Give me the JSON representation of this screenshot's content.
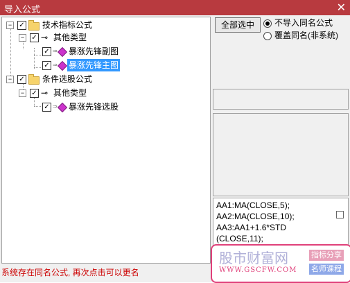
{
  "window": {
    "title": "导入公式",
    "close_glyph": "✕"
  },
  "tree": {
    "groups": [
      {
        "label": "技术指标公式",
        "subgroup": "其他类型",
        "items": [
          "暴涨先锋副图",
          "暴涨先锋主图"
        ]
      },
      {
        "label": "条件选股公式",
        "subgroup": "其他类型",
        "items": [
          "暴涨先锋选股"
        ]
      }
    ],
    "selected_item": "暴涨先锋主图"
  },
  "actions": {
    "select_all": "全部选中"
  },
  "options": {
    "no_import_same": "不导入同名公式",
    "overwrite_same": "覆盖同名(非系统)",
    "selected": "no_import_same"
  },
  "code": {
    "lines": [
      "AA1:MA(CLOSE,5);",
      "AA2:MA(CLOSE,10);",
      "AA3:AA1+1.6*STD",
      "(CLOSE,11);"
    ]
  },
  "status": "系统存在同名公式, 再次点击可以更名",
  "watermark": {
    "brand": "股市财富网",
    "url": "WWW.GSCFW.COM",
    "tag1": "指标分享",
    "tag2": "名师课程"
  },
  "colors": {
    "titlebar": "#b83a3f",
    "selection": "#3399ff",
    "status": "#cc0000"
  },
  "icons": [
    "close-icon",
    "expand-icon",
    "checkbox-icon",
    "folder-icon",
    "key-icon",
    "formula-gem-icon",
    "radio-icon"
  ]
}
